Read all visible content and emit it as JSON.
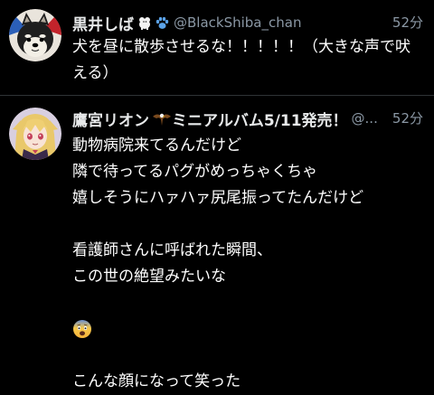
{
  "tweets": [
    {
      "display_name": "黒井しば",
      "badge_icons": [
        "dog-badge-icon",
        "paw-print-icon"
      ],
      "handle": "@BlackShiba_chan",
      "time": "52分",
      "body": "犬を昼に散歩させるな！！！！！（大きな声で吠える）",
      "avatar_icon": "shiba-dog-avatar"
    },
    {
      "display_name": "鷹宮リオン",
      "badge_icons": [
        "eagle-icon"
      ],
      "name_suffix": "ミニアルバム5/11発売！",
      "handle": "@...",
      "time": "52分",
      "avatar_icon": "blonde-anime-girl-avatar",
      "lines": [
        "動物病院来てるんだけど",
        "隣で待ってるパグがめっちゃくちゃ",
        "嬉しそうにハァハァ尻尾振ってたんだけど",
        "",
        "看護師さんに呼ばれた瞬間、",
        "この世の絶望みたいな",
        "",
        "😨",
        "",
        "こんな顔になって笑った"
      ]
    }
  ],
  "colors": {
    "background": "#000000",
    "text": "#ffffff",
    "secondary": "#8b98a5",
    "divider": "#2f3336"
  }
}
